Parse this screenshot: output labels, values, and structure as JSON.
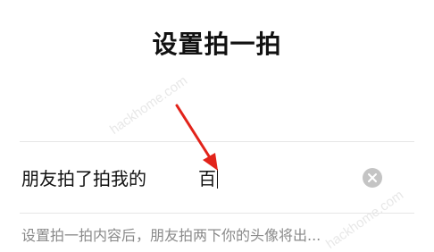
{
  "page": {
    "title": "设置拍一拍"
  },
  "pat_setting": {
    "prefix": "朋友拍了拍我的",
    "suffix_value": "百",
    "hint": "设置拍一拍内容后，朋友拍两下你的头像将出..."
  },
  "icons": {
    "clear": "clear-circle-icon",
    "arrow": "red-arrow-icon"
  },
  "colors": {
    "arrow": "#e2231a",
    "clear_button": "#c4c4c4",
    "hint_text": "#8a8a8a",
    "divider": "#e6e6e6"
  },
  "watermark": {
    "text": "hackhome.com"
  }
}
